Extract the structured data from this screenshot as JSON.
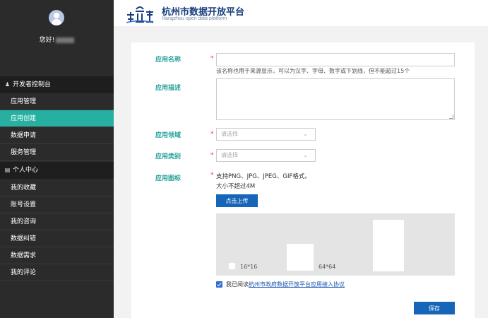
{
  "sidebar": {
    "greeting": "您好!",
    "sections": [
      {
        "title": "开发者控制台",
        "icon": "user-icon",
        "items": [
          "应用管理",
          "应用创建",
          "数据申请",
          "服务管理"
        ]
      },
      {
        "title": "个人中心",
        "icon": "card-icon",
        "items": [
          "我的收藏",
          "账号设置",
          "我的咨询",
          "数据纠错",
          "数据需求",
          "我的评论"
        ]
      }
    ],
    "active_item": "应用创建"
  },
  "header": {
    "title": "杭州市数据开放平台",
    "subtitle": "Hangzhou open data platform"
  },
  "form": {
    "app_name": {
      "label": "应用名称",
      "required": "*",
      "value": "",
      "hint": "该名称也用于来源显示，可以为汉字、字母、数字或下划线，但不能超过15个"
    },
    "app_desc": {
      "label": "应用描述",
      "value": ""
    },
    "app_domain": {
      "label": "应用领域",
      "required": "*",
      "placeholder": "请选择"
    },
    "app_type": {
      "label": "应用类别",
      "required": "*",
      "placeholder": "请选择"
    },
    "app_icon": {
      "label": "应用图标",
      "required": "*",
      "hint1": "支持PNG、JPG、JPEG、GIF格式。",
      "hint2": "大小不超过4M",
      "upload_label": "点击上传",
      "size_small": "16*16",
      "size_medium": "64*64"
    },
    "agreement": {
      "prefix": "我已阅读",
      "link": "杭州市政府数据开放平台应用接入协议",
      "checked": true
    },
    "save_label": "保存"
  },
  "colors": {
    "sidebar_bg": "#2b2b2b",
    "active": "#27b0a2",
    "label": "#27a49a",
    "primary_button": "#1565b8",
    "required": "#e23b3b"
  }
}
